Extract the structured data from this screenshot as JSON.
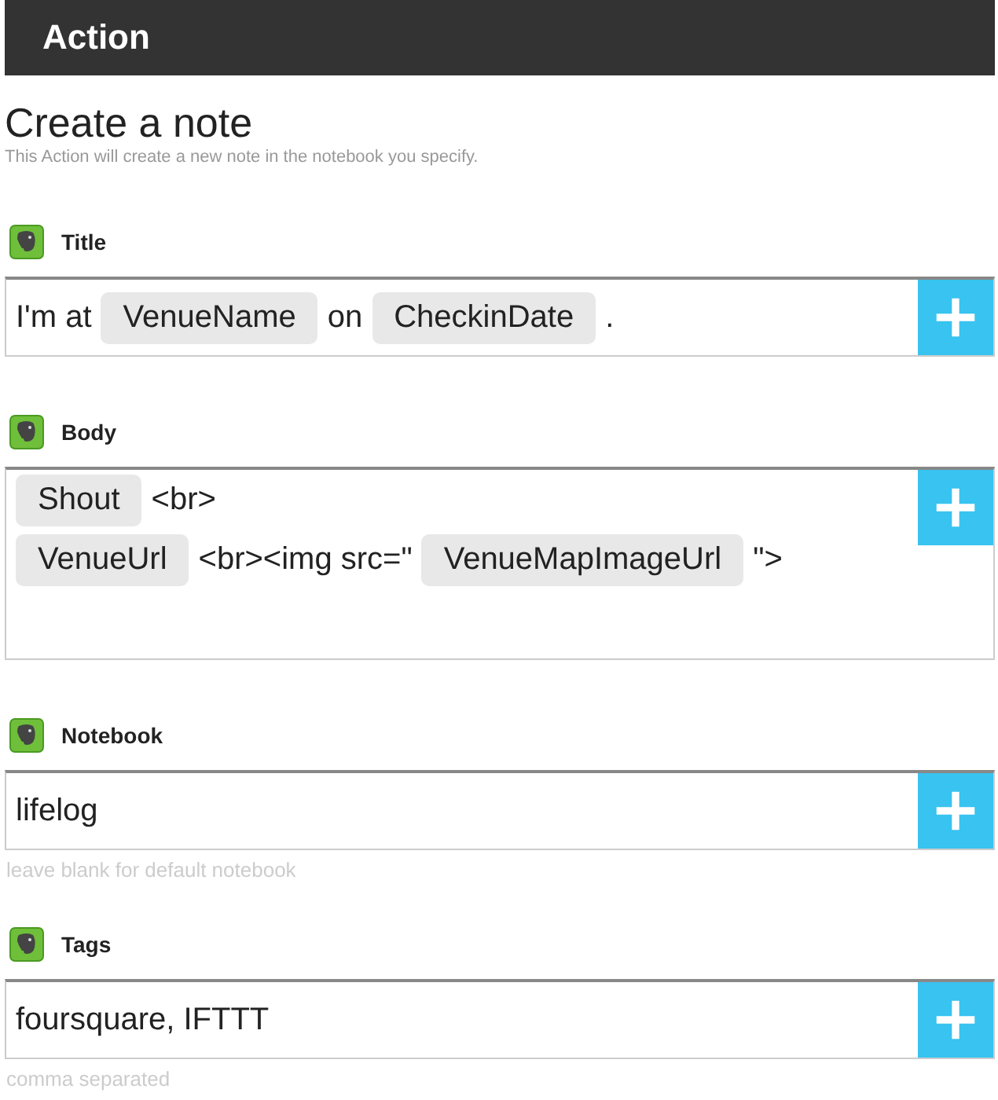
{
  "header": {
    "title": "Action"
  },
  "heading": "Create a note",
  "description": "This Action will create a new note in the notebook you specify.",
  "fields": [
    {
      "label": "Title",
      "tall": false,
      "lines": [
        [
          {
            "kind": "text",
            "text": "I'm at"
          },
          {
            "kind": "token",
            "text": "VenueName"
          },
          {
            "kind": "text",
            "text": "on"
          },
          {
            "kind": "token",
            "text": "CheckinDate"
          },
          {
            "kind": "text",
            "text": "."
          }
        ]
      ]
    },
    {
      "label": "Body",
      "tall": true,
      "lines": [
        [
          {
            "kind": "token",
            "text": "Shout"
          },
          {
            "kind": "text",
            "text": "<br>"
          }
        ],
        [
          {
            "kind": "token",
            "text": "VenueUrl"
          },
          {
            "kind": "text",
            "text": "<br><img src=\""
          },
          {
            "kind": "token",
            "text": "VenueMapImageUrl"
          },
          {
            "kind": "text",
            "text": "\">"
          }
        ]
      ]
    },
    {
      "label": "Notebook",
      "tall": false,
      "lines": [
        [
          {
            "kind": "text",
            "text": "lifelog"
          }
        ]
      ],
      "hint": "leave blank for default notebook"
    },
    {
      "label": "Tags",
      "tall": false,
      "lines": [
        [
          {
            "kind": "text",
            "text": "foursquare, IFTTT"
          }
        ]
      ],
      "hint": "comma separated"
    }
  ]
}
